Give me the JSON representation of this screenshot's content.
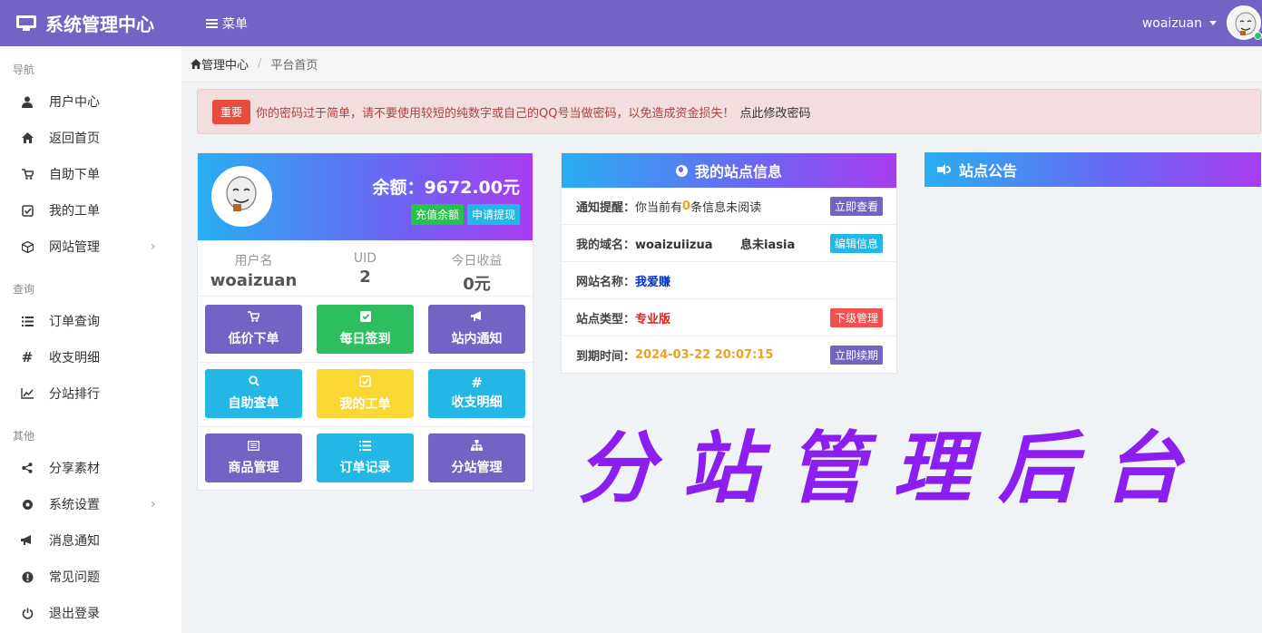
{
  "topbar": {
    "title": "系统管理中心",
    "menu_label": "菜单",
    "username": "woaizuan"
  },
  "sidebar": {
    "sections": [
      {
        "label": "导航",
        "items": [
          {
            "label": "用户中心",
            "icon": "user-icon"
          },
          {
            "label": "返回首页",
            "icon": "home-icon"
          },
          {
            "label": "自助下单",
            "icon": "cart-icon"
          },
          {
            "label": "我的工单",
            "icon": "check-square-icon"
          },
          {
            "label": "网站管理",
            "icon": "cube-icon",
            "has_submenu": true
          }
        ]
      },
      {
        "label": "查询",
        "items": [
          {
            "label": "订单查询",
            "icon": "list-icon"
          },
          {
            "label": "收支明细",
            "icon": "hash-icon"
          },
          {
            "label": "分站排行",
            "icon": "line-chart-icon"
          }
        ]
      },
      {
        "label": "其他",
        "items": [
          {
            "label": "分享素材",
            "icon": "share-icon"
          },
          {
            "label": "系统设置",
            "icon": "settings-icon",
            "has_submenu": true
          },
          {
            "label": "消息通知",
            "icon": "bullhorn-icon"
          },
          {
            "label": "常见问题",
            "icon": "exclamation-icon"
          },
          {
            "label": "退出登录",
            "icon": "power-icon"
          }
        ]
      }
    ]
  },
  "breadcrumb": {
    "home": "管理中心",
    "current": "平台首页"
  },
  "alert": {
    "tag": "重要",
    "message": "你的密码过于简单，请不要使用较短的纯数字或自己的QQ号当做密码，以免造成资金损失！",
    "link": "点此修改密码"
  },
  "user_card": {
    "balance": "余额：9672.00元",
    "recharge_label": "充值余额",
    "withdraw_label": "申请提现",
    "stats": [
      {
        "key": "用户名",
        "value": "woaizuan"
      },
      {
        "key": "UID",
        "value": "2"
      },
      {
        "key": "今日收益",
        "value": "0元"
      }
    ],
    "buttons": [
      {
        "label": "低价下单",
        "icon": "cart-icon",
        "color": "#7263c4"
      },
      {
        "label": "每日签到",
        "icon": "check-icon",
        "color": "#2dbe60"
      },
      {
        "label": "站内通知",
        "icon": "bullhorn-icon",
        "color": "#7263c4"
      },
      {
        "label": "自助查单",
        "icon": "search-icon",
        "color": "#23b7e5"
      },
      {
        "label": "我的工单",
        "icon": "check-square-icon",
        "color": "#fad733"
      },
      {
        "label": "收支明细",
        "icon": "hash-icon",
        "color": "#23b7e5"
      },
      {
        "label": "商品管理",
        "icon": "list-alt-icon",
        "color": "#7263c4"
      },
      {
        "label": "订单记录",
        "icon": "list-icon",
        "color": "#23b7e5"
      },
      {
        "label": "分站管理",
        "icon": "sitemap-icon",
        "color": "#7263c4"
      }
    ]
  },
  "site_info": {
    "title": "我的站点信息",
    "rows": [
      {
        "key": "通知提醒：",
        "value_pre": "你当前有",
        "value_highlight": "0",
        "value_post": "条信息未阅读",
        "button": "立即查看",
        "button_color": "#7263c4"
      },
      {
        "key": "我的域名：",
        "value": "woaizuiizua  　　息未iasia",
        "button": "编辑信息",
        "button_color": "#23b7e5"
      },
      {
        "key": "网站名称：",
        "value": "我爱赚",
        "value_color": "#0033cc"
      },
      {
        "key": "站点类型：",
        "value": "专业版",
        "value_color": "#e02020",
        "button": "下级管理",
        "button_color": "#f05050"
      },
      {
        "key": "到期时间：",
        "value": "2024-03-22 20:07:15",
        "value_color": "#f0a020",
        "button": "立即续期",
        "button_color": "#7263c4"
      }
    ]
  },
  "notice": {
    "title": "站点公告"
  },
  "watermark": "分站管理后台"
}
